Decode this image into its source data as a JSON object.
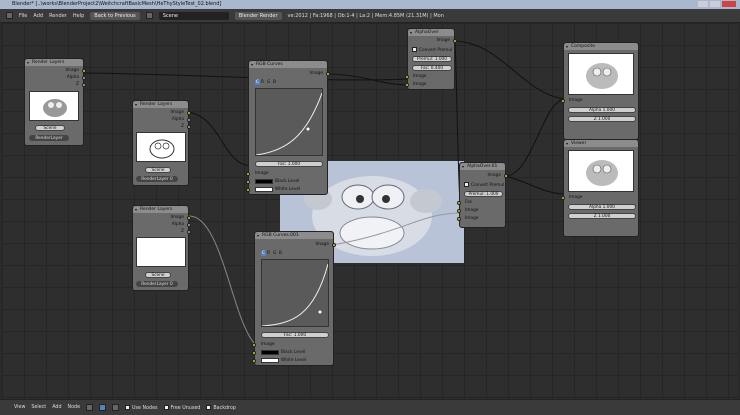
{
  "window": {
    "title": "Blender* [..\\works\\BlenderProject2\\WeitchcraftBasicMesh\\HeThyStyleTest_02.blend]"
  },
  "header": {
    "menus": [
      "File",
      "Add",
      "Render",
      "Help"
    ],
    "back_label": "Back to Previous",
    "scene_value": "Scene",
    "engine_value": "Blender Render",
    "stats": "ve:2012 | Fa:1968 | Ob:1-4 | La:2 | Mem:4.85M (21.31M) | Mon"
  },
  "nodes": {
    "rl1": {
      "title": "Render Layers",
      "out": [
        "Image",
        "Alpha",
        "Z"
      ],
      "scene": "Scene",
      "layer": "RenderLayer"
    },
    "rl2": {
      "title": "Render Layers",
      "out": [
        "Image",
        "Alpha",
        "Z"
      ],
      "scene": "Scene",
      "layer": "RenderLayer 0"
    },
    "rl3": {
      "title": "Render Layers",
      "out": [
        "Image",
        "Alpha",
        "Z"
      ],
      "scene": "Scene",
      "layer": "RenderLayer 0"
    },
    "curves1": {
      "title": "RGB Curves",
      "out": "Image",
      "tabs": [
        "C",
        "R",
        "G",
        "B"
      ],
      "fac": "Fac: 1.000",
      "in": [
        "Image",
        "Black Level",
        "White Level"
      ]
    },
    "curves2": {
      "title": "RGB Curves.001",
      "out": "Image",
      "tabs": [
        "C",
        "R",
        "G",
        "B"
      ],
      "fac": "Fac: 1.000",
      "in": [
        "Image",
        "Black Level",
        "White Level"
      ]
    },
    "alpha1": {
      "title": "AlphaOver",
      "out": "Image",
      "convert": "Convert Premul",
      "premul": "Premul: 1.000",
      "fac": "Fac: 0.400",
      "in": [
        "Image",
        "Image"
      ]
    },
    "alpha2": {
      "title": "AlphaOver.01",
      "out": "Image",
      "convert": "Convert Premul",
      "premul": "Premul: 1.000",
      "fac": "Fac",
      "in": [
        "Image",
        "Image"
      ]
    },
    "composite": {
      "title": "Composite",
      "in": "Image",
      "alpha": "Alpha 1.000",
      "z": "Z 1.000"
    },
    "viewer": {
      "title": "Viewer",
      "in": "Image",
      "alpha": "Alpha 1.000",
      "z": "Z 1.000"
    }
  },
  "footer": {
    "menus": [
      "View",
      "Select",
      "Add",
      "Node"
    ],
    "use_nodes": "Use Nodes",
    "free_unused": "Free Unused",
    "backdrop": "Backdrop"
  },
  "colors": {
    "socket": "#cccc33",
    "node_body": "#6a6a6a",
    "backdrop_bg": "#b9c3d8"
  }
}
